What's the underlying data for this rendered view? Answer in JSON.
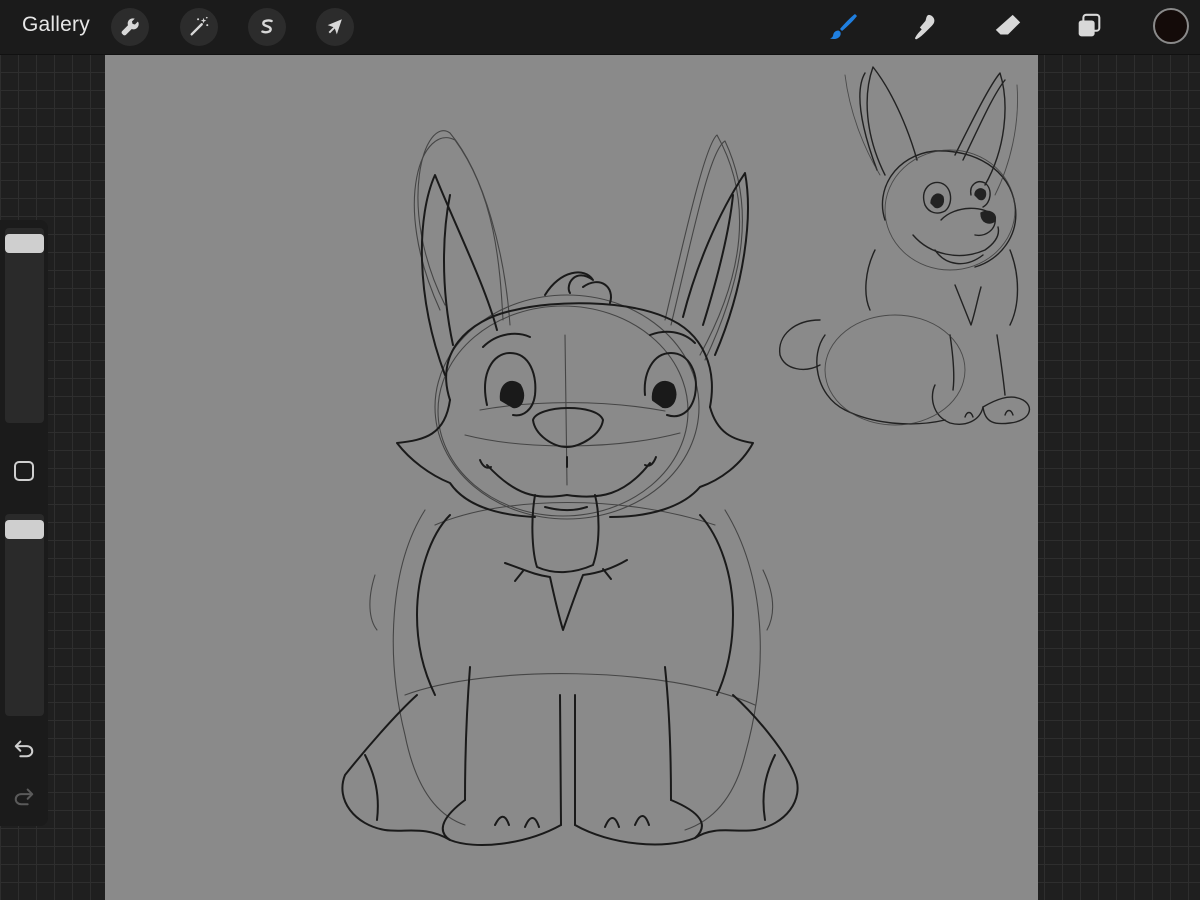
{
  "topbar": {
    "gallery_label": "Gallery",
    "left_tools": [
      {
        "name": "actions",
        "icon": "wrench-icon"
      },
      {
        "name": "adjustments",
        "icon": "magic-wand-icon"
      },
      {
        "name": "selection",
        "icon": "selection-s-icon"
      },
      {
        "name": "transform",
        "icon": "arrow-cursor-icon"
      }
    ],
    "right_tools": [
      {
        "name": "brush",
        "icon": "brush-icon",
        "active": true
      },
      {
        "name": "smudge",
        "icon": "smudge-finger-icon"
      },
      {
        "name": "eraser",
        "icon": "eraser-icon"
      },
      {
        "name": "layers",
        "icon": "layers-icon"
      }
    ],
    "current_color": "#140b09"
  },
  "sidebar": {
    "brush_size_level": 0.0,
    "opacity_level": 0.0,
    "modify_icon": "square-outline-icon",
    "undo_icon": "undo-arrow-icon",
    "redo_icon": "redo-arrow-icon"
  },
  "canvas": {
    "background_color": "#8a8a8a",
    "accent_color": "#1f7fe0"
  }
}
